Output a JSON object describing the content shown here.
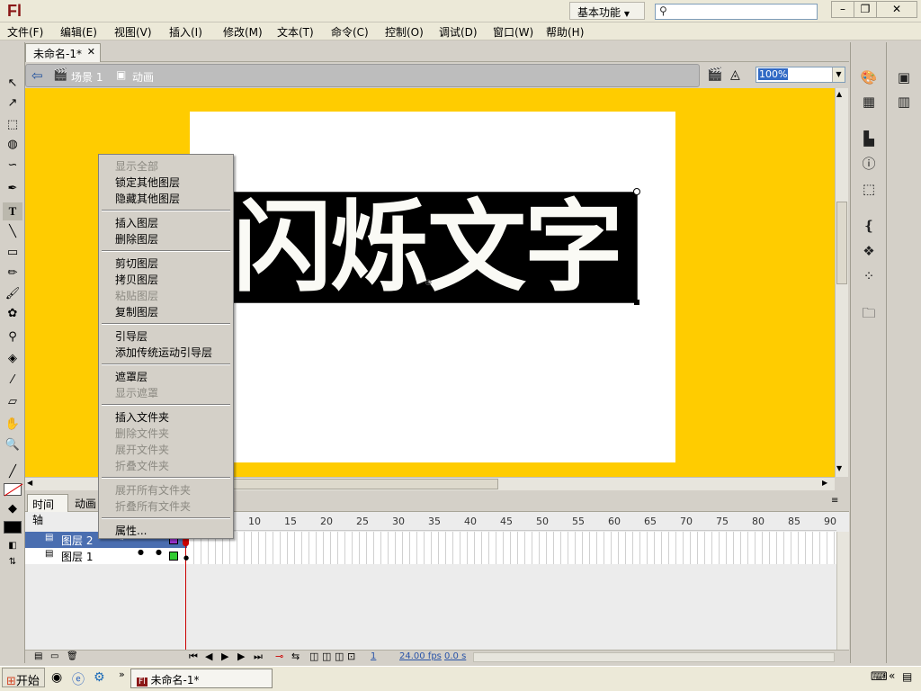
{
  "app": {
    "logo": "Fl",
    "workspace_label": "基本功能",
    "search_placeholder": "",
    "window_buttons": [
      "–",
      "❐",
      "✕"
    ]
  },
  "menubar": {
    "items": [
      "文件(F)",
      "编辑(E)",
      "视图(V)",
      "插入(I)",
      "修改(M)",
      "文本(T)",
      "命令(C)",
      "控制(O)",
      "调试(D)",
      "窗口(W)",
      "帮助(H)"
    ]
  },
  "document": {
    "tab_title": "未命名-1*",
    "close_glyph": "✕"
  },
  "editbar": {
    "scene_label": "场景 1",
    "symbol_label": "动画",
    "zoom_value": "100%"
  },
  "stage": {
    "background_color": "#ffcc00",
    "canvas_color": "#ffffff",
    "text_content": "闪烁文字"
  },
  "context_menu": {
    "groups": [
      [
        {
          "label": "显示全部",
          "enabled": false
        },
        {
          "label": "锁定其他图层",
          "enabled": true
        },
        {
          "label": "隐藏其他图层",
          "enabled": true
        }
      ],
      [
        {
          "label": "插入图层",
          "enabled": true
        },
        {
          "label": "删除图层",
          "enabled": true
        }
      ],
      [
        {
          "label": "剪切图层",
          "enabled": true
        },
        {
          "label": "拷贝图层",
          "enabled": true
        },
        {
          "label": "粘贴图层",
          "enabled": false
        },
        {
          "label": "复制图层",
          "enabled": true
        }
      ],
      [
        {
          "label": "引导层",
          "enabled": true
        },
        {
          "label": "添加传统运动引导层",
          "enabled": true
        }
      ],
      [
        {
          "label": "遮罩层",
          "enabled": true
        },
        {
          "label": "显示遮罩",
          "enabled": false
        }
      ],
      [
        {
          "label": "插入文件夹",
          "enabled": true
        },
        {
          "label": "删除文件夹",
          "enabled": false
        },
        {
          "label": "展开文件夹",
          "enabled": false
        },
        {
          "label": "折叠文件夹",
          "enabled": false
        }
      ],
      [
        {
          "label": "展开所有文件夹",
          "enabled": false
        },
        {
          "label": "折叠所有文件夹",
          "enabled": false
        }
      ],
      [
        {
          "label": "属性...",
          "enabled": true
        }
      ]
    ]
  },
  "timeline": {
    "tabs": [
      "时间轴",
      "动画"
    ],
    "frame_numbers": [
      "10",
      "15",
      "20",
      "25",
      "30",
      "35",
      "40",
      "45",
      "50",
      "55",
      "60",
      "65",
      "70",
      "75",
      "80",
      "85",
      "90"
    ],
    "layers": [
      {
        "name": "图层 2",
        "selected": true,
        "color": "#9933cc"
      },
      {
        "name": "图层 1",
        "selected": false,
        "color": "#33cc33"
      }
    ],
    "status": {
      "current_frame": "1",
      "fps": "24.00 fps",
      "time": "0.0 s"
    }
  },
  "taskbar": {
    "start_label": "开始",
    "task_label": "未命名-1*"
  }
}
